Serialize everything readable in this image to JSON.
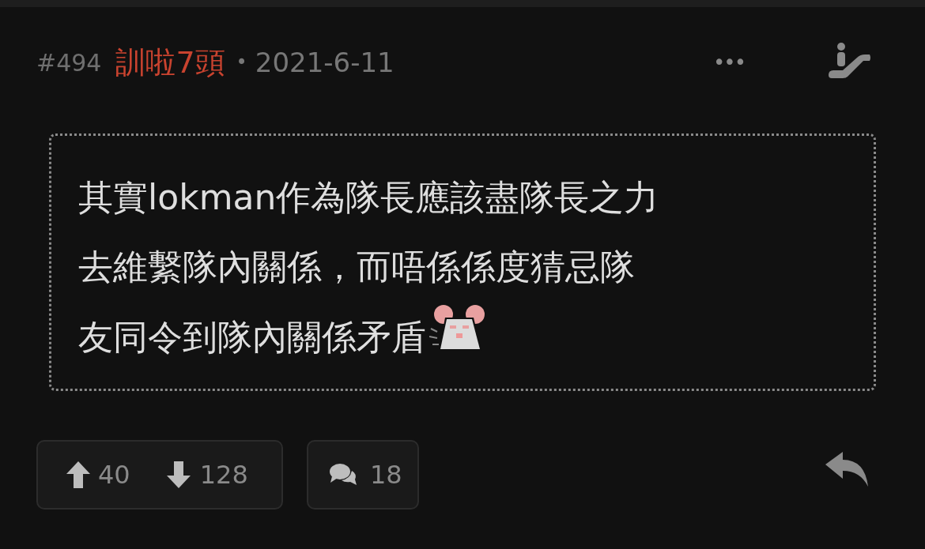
{
  "post": {
    "number": "#494",
    "author": "訓啦7頭",
    "separator": "•",
    "date": "2021-6-11",
    "more": "•••",
    "body_lines": [
      "其實lokman作為隊長應該盡隊長之力",
      "去維繫隊內關係，而唔係係度猜忌隊",
      "友同令到隊內關係矛盾"
    ],
    "upvotes": "40",
    "downvotes": "128",
    "comments": "18"
  }
}
